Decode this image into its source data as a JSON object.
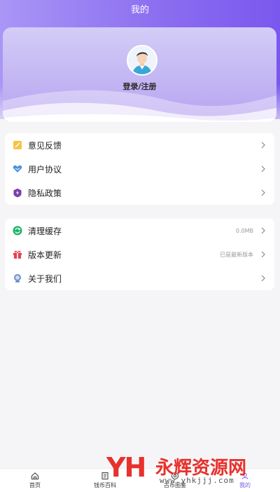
{
  "header": {
    "title": "我的"
  },
  "profile": {
    "login_label": "登录/注册"
  },
  "menu_group_1": [
    {
      "label": "意见反馈",
      "icon": "feedback-icon",
      "value": ""
    },
    {
      "label": "用户协议",
      "icon": "agreement-icon",
      "value": ""
    },
    {
      "label": "隐私政策",
      "icon": "privacy-shield-icon",
      "value": ""
    }
  ],
  "menu_group_2": [
    {
      "label": "清理缓存",
      "icon": "clear-cache-icon",
      "value": "0.0MB"
    },
    {
      "label": "版本更新",
      "icon": "gift-update-icon",
      "value": "已是最新版本"
    },
    {
      "label": "关于我们",
      "icon": "about-us-icon",
      "value": ""
    }
  ],
  "tabbar": {
    "items": [
      {
        "label": "首页",
        "icon": "home-icon",
        "active": false
      },
      {
        "label": "钱币百科",
        "icon": "encyclopedia-icon",
        "active": false
      },
      {
        "label": "古币图鉴",
        "icon": "coin-catalog-icon",
        "active": false
      },
      {
        "label": "我的",
        "icon": "profile-icon",
        "active": true
      }
    ]
  },
  "watermark": {
    "logo": "YH",
    "title": "永辉资源网",
    "url": "www.yhkjjj.com"
  },
  "colors": {
    "accent": "#7a58ee",
    "gradient_start": "#a996f6",
    "page_bg": "#f5f5f7"
  }
}
